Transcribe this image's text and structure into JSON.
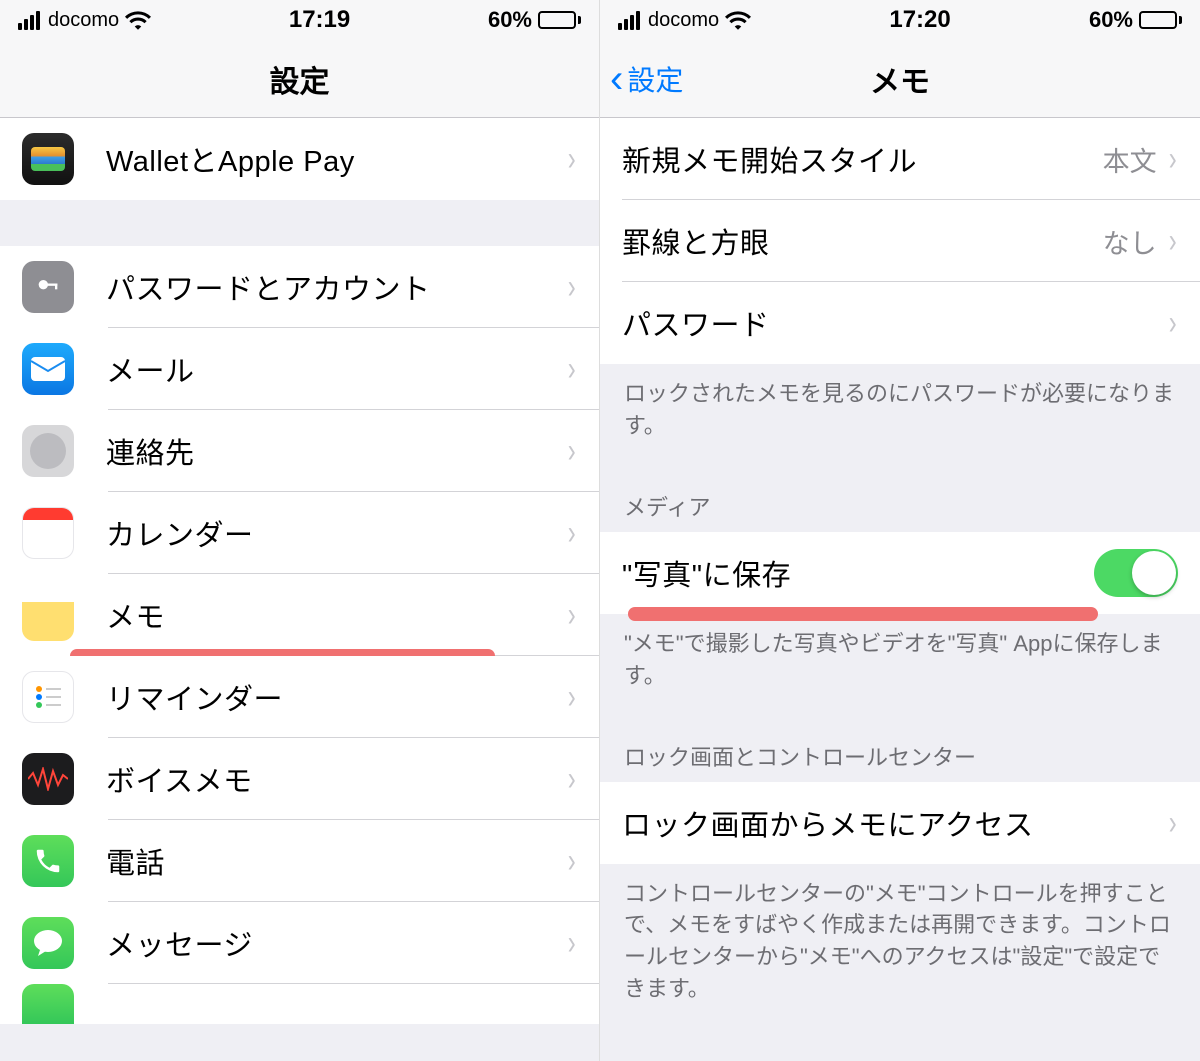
{
  "left": {
    "status": {
      "carrier": "docomo",
      "time": "17:19",
      "battery_pct": "60%",
      "battery_fill": 60
    },
    "nav": {
      "title": "設定"
    },
    "rows": {
      "wallet": "WalletとApple Pay",
      "passwords": "パスワードとアカウント",
      "mail": "メール",
      "contacts": "連絡先",
      "calendar": "カレンダー",
      "notes": "メモ",
      "reminders": "リマインダー",
      "voicememo": "ボイスメモ",
      "phone": "電話",
      "messages": "メッセージ"
    }
  },
  "right": {
    "status": {
      "carrier": "docomo",
      "time": "17:20",
      "battery_pct": "60%",
      "battery_fill": 60
    },
    "nav": {
      "back": "設定",
      "title": "メモ"
    },
    "rows": {
      "new_note_style": {
        "label": "新規メモ開始スタイル",
        "value": "本文"
      },
      "lines_grids": {
        "label": "罫線と方眼",
        "value": "なし"
      },
      "password": {
        "label": "パスワード"
      },
      "save_to_photos": {
        "label": "\"写真\"に保存",
        "on": true
      },
      "lock_access": {
        "label": "ロック画面からメモにアクセス"
      }
    },
    "footers": {
      "password": "ロックされたメモを見るのにパスワードが必要になります。",
      "save_to_photos": "\"メモ\"で撮影した写真やビデオを\"写真\" Appに保存します。",
      "lock_access": "コントロールセンターの\"メモ\"コントロールを押すことで、メモをすばやく作成または再開できます。コントロールセンターから\"メモ\"へのアクセスは\"設定\"で設定できます。"
    },
    "headers": {
      "media": "メディア",
      "lock": "ロック画面とコントロールセンター"
    }
  }
}
